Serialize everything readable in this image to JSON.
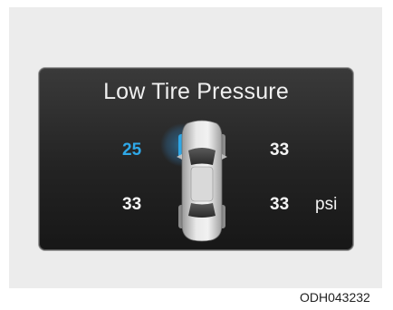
{
  "display": {
    "title": "Low Tire Pressure",
    "unit": "psi",
    "tires": {
      "front_left": {
        "value": "25",
        "status": "low"
      },
      "front_right": {
        "value": "33",
        "status": "normal"
      },
      "rear_left": {
        "value": "33",
        "status": "normal"
      },
      "rear_right": {
        "value": "33",
        "status": "normal"
      }
    }
  },
  "image_code": "ODH043232",
  "colors": {
    "low_pressure": "#2fa8e8",
    "normal_text": "#f4f4f4",
    "panel_background": "#232323"
  },
  "icons": {
    "vehicle": "car-top-view-icon",
    "low_tire_highlight": "low-tire-highlight-icon"
  }
}
